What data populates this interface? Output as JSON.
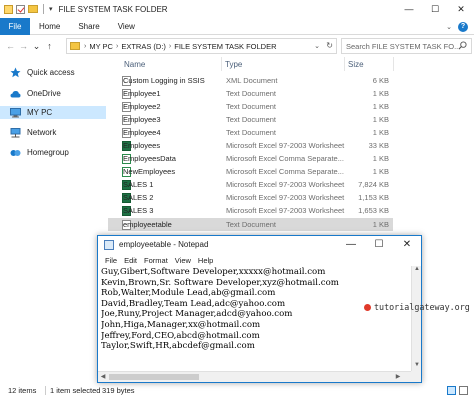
{
  "window": {
    "title": "FILE SYSTEM TASK FOLDER",
    "qa_separator": "|",
    "qa_dropdown": "▾",
    "controls": {
      "minimize": "—",
      "maximize": "☐",
      "close": "✕"
    }
  },
  "ribbon": {
    "file_label": "File",
    "tabs": [
      "Home",
      "Share",
      "View"
    ],
    "expand": "⌄",
    "help": "?"
  },
  "address": {
    "back": "←",
    "forward": "→",
    "recent": "⌄",
    "up": "↑",
    "crumbs": [
      "MY PC",
      "EXTRAS (D:)",
      "FILE SYSTEM TASK FOLDER"
    ],
    "separator": "›",
    "dropdown": "⌄",
    "refresh": "↻",
    "search_placeholder": "Search FILE SYSTEM TASK FO..."
  },
  "sidebar": {
    "items": [
      {
        "label": "Quick access",
        "icon": "star-icon"
      },
      {
        "label": "OneDrive",
        "icon": "cloud-icon"
      },
      {
        "label": "MY PC",
        "icon": "computer-icon",
        "selected": true
      },
      {
        "label": "Network",
        "icon": "network-icon"
      },
      {
        "label": "Homegroup",
        "icon": "homegroup-icon"
      }
    ]
  },
  "filelist": {
    "columns": [
      "Name",
      "Type",
      "Size"
    ],
    "files": [
      {
        "name": "Custom Logging in SSIS",
        "type": "XML Document",
        "size": "6 KB",
        "icon": "doc"
      },
      {
        "name": "Employee1",
        "type": "Text Document",
        "size": "1 KB",
        "icon": "doc"
      },
      {
        "name": "Employee2",
        "type": "Text Document",
        "size": "1 KB",
        "icon": "doc"
      },
      {
        "name": "Employee3",
        "type": "Text Document",
        "size": "1 KB",
        "icon": "doc"
      },
      {
        "name": "Employee4",
        "type": "Text Document",
        "size": "1 KB",
        "icon": "doc"
      },
      {
        "name": "Employees",
        "type": "Microsoft Excel 97-2003 Worksheet",
        "size": "33 KB",
        "icon": "xls"
      },
      {
        "name": "EmployeesData",
        "type": "Microsoft Excel Comma Separate...",
        "size": "1 KB",
        "icon": "csv"
      },
      {
        "name": "NewEmployees",
        "type": "Microsoft Excel Comma Separate...",
        "size": "1 KB",
        "icon": "csv"
      },
      {
        "name": "SALES 1",
        "type": "Microsoft Excel 97-2003 Worksheet",
        "size": "7,824 KB",
        "icon": "xls"
      },
      {
        "name": "SALES 2",
        "type": "Microsoft Excel 97-2003 Worksheet",
        "size": "1,153 KB",
        "icon": "xls"
      },
      {
        "name": "SALES 3",
        "type": "Microsoft Excel 97-2003 Worksheet",
        "size": "1,653 KB",
        "icon": "xls"
      },
      {
        "name": "employeetable",
        "type": "Text Document",
        "size": "1 KB",
        "icon": "doc",
        "selected": true
      }
    ]
  },
  "status": {
    "items_count": "12 items",
    "selected": "1 item selected",
    "selected_size": "319 bytes"
  },
  "notepad": {
    "title": "employeetable - Notepad",
    "menu": [
      "File",
      "Edit",
      "Format",
      "View",
      "Help"
    ],
    "content": "Guy,Gibert,Software Developer,xxxxx@hotmail.com\nKevin,Brown,Sr. Software Developer,xyz@hotmail.com\nRob,Walter,Module Lead,ab@gmail.com\nDavid,Bradley,Team Lead,adc@yahoo.com\nJoe,Runy,Project Manager,adcd@yahoo.com\nJohn,Higa,Manager,xx@hotmail.com\nJeffrey,Ford,CEO,abcd@hotmail.com\nTaylor,Swift,HR,abcdef@gmail.com",
    "controls": {
      "minimize": "—",
      "maximize": "☐",
      "close": "✕"
    },
    "scroll_up": "▲",
    "scroll_down": "▼",
    "scroll_left": "◀",
    "scroll_right": "▶"
  },
  "watermark": {
    "text": "tutorialgateway.org"
  },
  "colors": {
    "accent": "#1979ca",
    "selected_bg": "#cce8ff",
    "row_selected": "#d9d9d9",
    "excel_green": "#1e7145",
    "watermark_dot": "#e03a2a"
  }
}
